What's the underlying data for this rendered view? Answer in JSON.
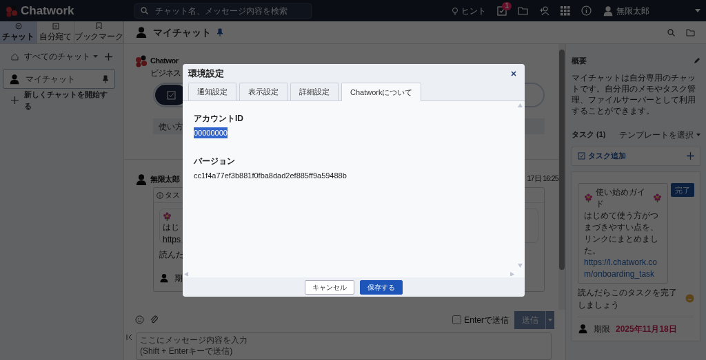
{
  "top_bar": {
    "brand": "Chatwork",
    "search": {
      "placeholder": "チャット名、メッセージ内容を検索"
    },
    "hint": "ヒント",
    "task_badge": "1",
    "user": "無限太郎"
  },
  "sidebar": {
    "tabs": [
      {
        "label": "チャット",
        "selected": true
      },
      {
        "label": "自分宛て",
        "selected": false
      },
      {
        "label": "ブックマーク",
        "selected": false
      }
    ],
    "filter": "すべてのチャット",
    "rooms": [
      {
        "name": "マイチャット",
        "selected": true,
        "pinned": true
      }
    ],
    "new_chat": "新しくチャットを開始する"
  },
  "room": {
    "title": "マイチャット",
    "pinned": true
  },
  "timeline": {
    "welcome": {
      "sender": "Chatwor",
      "text": "ビジネス"
    },
    "guide": "使い方",
    "message": {
      "sender": "無限太郎",
      "time": "17日 16:25",
      "header": "タス",
      "lines": [
        "はじ",
        "https"
      ],
      "footer": "読んだ",
      "due": "期"
    }
  },
  "composer": {
    "enter_to_send": {
      "label": "Enterで送信",
      "checked": false
    },
    "send": {
      "label": "送信",
      "disabled": true
    },
    "placeholder": "ここにメッセージ内容を入力\n(Shift + Enterキーで送信)"
  },
  "summary": {
    "title": "概要",
    "text": "マイチャットは自分専用のチャットです。自分用のメモやタスク管理、ファイルサーバーとして利用することができます。"
  },
  "tasks": {
    "title": "タスク",
    "count": "(1)",
    "template": "テンプレートを選択",
    "add": "タスク追加",
    "items": [
      {
        "title": "使い始めガイド",
        "body": "はじめて使う方がつまづきやすい点を、リンクにまとめました。",
        "link": "https://l.chatwork.com/onboarding_task",
        "done_button": "完了",
        "note": "読んだらこのタスクを完了しましょう",
        "due_label": "期限",
        "due": "2025年11月18日"
      }
    ]
  },
  "dialog": {
    "title": "環境設定",
    "tabs": [
      {
        "label": "通知設定",
        "selected": false
      },
      {
        "label": "表示設定",
        "selected": false
      },
      {
        "label": "詳細設定",
        "selected": false
      },
      {
        "label": "Chatworkについて",
        "selected": true
      }
    ],
    "fields": [
      {
        "label": "アカウントID",
        "value": "00000000",
        "highlighted": true
      },
      {
        "label": "バージョン",
        "value": "cc1f4a77ef3b881f0fba8dad2ef885ff9a59488b",
        "highlighted": false
      }
    ],
    "buttons": [
      {
        "label": "キャンセル",
        "kind": "secondary"
      },
      {
        "label": "保存する",
        "kind": "primary"
      }
    ]
  }
}
